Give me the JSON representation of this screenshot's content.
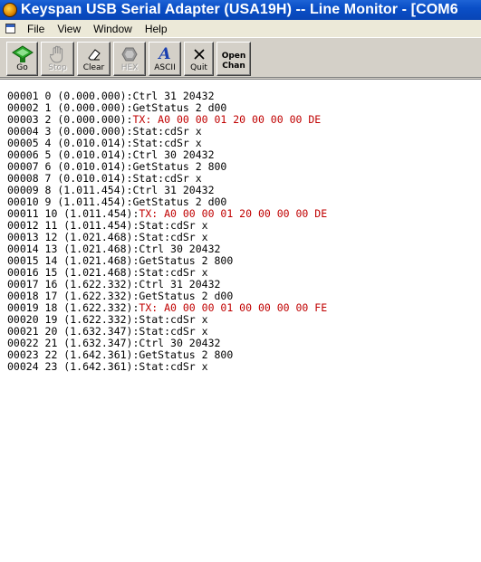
{
  "window": {
    "title": "Keyspan USB Serial Adapter (USA19H) -- Line Monitor - [COM6"
  },
  "menu": {
    "items": [
      "File",
      "View",
      "Window",
      "Help"
    ]
  },
  "toolbar": {
    "buttons": [
      {
        "label": "Go",
        "icon": "go-icon",
        "enabled": true
      },
      {
        "label": "Stop",
        "icon": "stop-hand-icon",
        "enabled": false
      },
      {
        "label": "Clear",
        "icon": "eraser-icon",
        "enabled": true
      },
      {
        "label": "HEX",
        "icon": "hex-icon",
        "enabled": false
      },
      {
        "label": "ASCII",
        "icon": "ascii-icon",
        "enabled": true
      },
      {
        "label": "Quit",
        "icon": "close-icon",
        "enabled": true
      },
      {
        "label": "Open\nChan",
        "icon": "",
        "enabled": true
      }
    ]
  },
  "colors": {
    "tx_line": "#c00000",
    "titlebar": "#0a4fc7",
    "go_icon": "#20a020"
  },
  "log": [
    {
      "prefix": "00001 0 (0.000.000):",
      "msg": "Ctrl 31 20432",
      "tx": false
    },
    {
      "prefix": "00002 1 (0.000.000):",
      "msg": "GetStatus 2 d00",
      "tx": false
    },
    {
      "prefix": "00003 2 (0.000.000):",
      "msg": "TX: A0 00 00 01 20 00 00 00 DE",
      "tx": true
    },
    {
      "prefix": "00004 3 (0.000.000):",
      "msg": "Stat:cdSr x",
      "tx": false
    },
    {
      "prefix": "00005 4 (0.010.014):",
      "msg": "Stat:cdSr x",
      "tx": false
    },
    {
      "prefix": "00006 5 (0.010.014):",
      "msg": "Ctrl 30 20432",
      "tx": false
    },
    {
      "prefix": "00007 6 (0.010.014):",
      "msg": "GetStatus 2 800",
      "tx": false
    },
    {
      "prefix": "00008 7 (0.010.014):",
      "msg": "Stat:cdSr x",
      "tx": false
    },
    {
      "prefix": "00009 8 (1.011.454):",
      "msg": "Ctrl 31 20432",
      "tx": false
    },
    {
      "prefix": "00010 9 (1.011.454):",
      "msg": "GetStatus 2 d00",
      "tx": false
    },
    {
      "prefix": "00011 10 (1.011.454):",
      "msg": "TX: A0 00 00 01 20 00 00 00 DE",
      "tx": true
    },
    {
      "prefix": "00012 11 (1.011.454):",
      "msg": "Stat:cdSr x",
      "tx": false
    },
    {
      "prefix": "00013 12 (1.021.468):",
      "msg": "Stat:cdSr x",
      "tx": false
    },
    {
      "prefix": "00014 13 (1.021.468):",
      "msg": "Ctrl 30 20432",
      "tx": false
    },
    {
      "prefix": "00015 14 (1.021.468):",
      "msg": "GetStatus 2 800",
      "tx": false
    },
    {
      "prefix": "00016 15 (1.021.468):",
      "msg": "Stat:cdSr x",
      "tx": false
    },
    {
      "prefix": "00017 16 (1.622.332):",
      "msg": "Ctrl 31 20432",
      "tx": false
    },
    {
      "prefix": "00018 17 (1.622.332):",
      "msg": "GetStatus 2 d00",
      "tx": false
    },
    {
      "prefix": "00019 18 (1.622.332):",
      "msg": "TX: A0 00 00 01 00 00 00 00 FE",
      "tx": true
    },
    {
      "prefix": "00020 19 (1.622.332):",
      "msg": "Stat:cdSr x",
      "tx": false
    },
    {
      "prefix": "00021 20 (1.632.347):",
      "msg": "Stat:cdSr x",
      "tx": false
    },
    {
      "prefix": "00022 21 (1.632.347):",
      "msg": "Ctrl 30 20432",
      "tx": false
    },
    {
      "prefix": "00023 22 (1.642.361):",
      "msg": "GetStatus 2 800",
      "tx": false
    },
    {
      "prefix": "00024 23 (1.642.361):",
      "msg": "Stat:cdSr x",
      "tx": false
    }
  ]
}
